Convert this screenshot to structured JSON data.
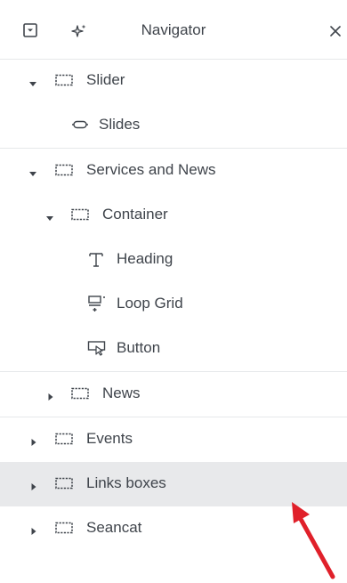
{
  "header": {
    "title": "Navigator",
    "icons": {
      "collapse": "collapse-all-icon",
      "sparkle": "ai-sparkle-icon",
      "close": "close-icon"
    }
  },
  "tree": [
    {
      "label": "Slider",
      "depth": 0,
      "expanded": true,
      "icon": "container-icon"
    },
    {
      "label": "Slides",
      "depth": 1,
      "icon": "slides-widget-icon"
    },
    {
      "label": "Services and News",
      "depth": 0,
      "expanded": true,
      "icon": "container-icon"
    },
    {
      "label": "Container",
      "depth": 1,
      "expanded": true,
      "icon": "container-icon"
    },
    {
      "label": "Heading",
      "depth": 2,
      "icon": "heading-widget-icon"
    },
    {
      "label": "Loop Grid",
      "depth": 2,
      "icon": "loop-grid-widget-icon"
    },
    {
      "label": "Button",
      "depth": 2,
      "icon": "button-widget-icon"
    },
    {
      "label": "News",
      "depth": 1,
      "expanded": false,
      "icon": "container-icon"
    },
    {
      "label": "Events",
      "depth": 0,
      "expanded": false,
      "icon": "container-icon"
    },
    {
      "label": "Links boxes",
      "depth": 0,
      "expanded": false,
      "selected": true,
      "icon": "container-icon"
    },
    {
      "label": "Seancat",
      "depth": 0,
      "expanded": false,
      "icon": "container-icon"
    }
  ],
  "annotation": {
    "icon": "red-arrow-icon",
    "color": "#e0202a"
  },
  "colors": {
    "text": "#3f444b",
    "divider": "#e6e8ea",
    "selected_bg": "#e8e9eb"
  }
}
